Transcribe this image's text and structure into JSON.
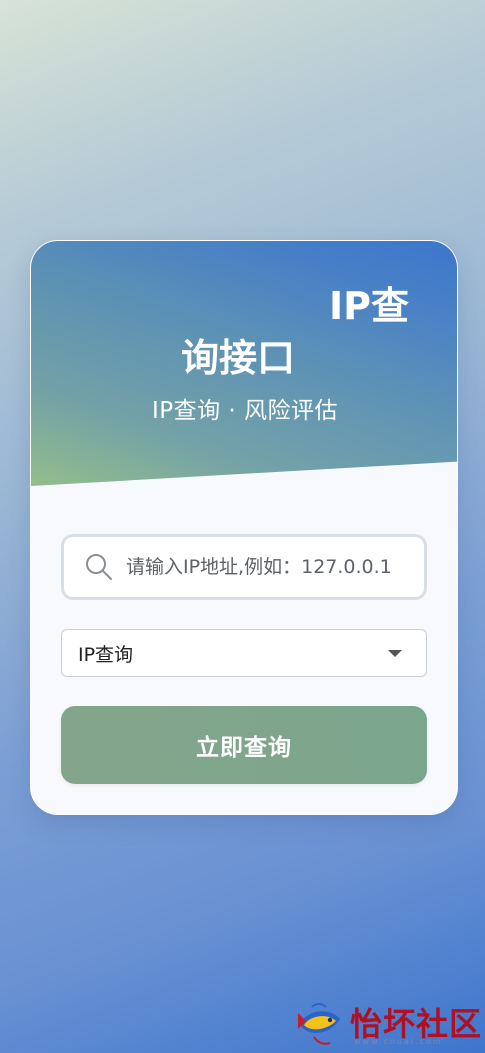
{
  "header": {
    "title_line1": "IP查",
    "title_line2": "询接口",
    "subtitle": "IP查询 · 风险评估"
  },
  "search": {
    "placeholder": "请输入IP地址,例如：127.0.0.1",
    "value": ""
  },
  "query_type": {
    "selected": "IP查询"
  },
  "submit": {
    "label": "立即查询"
  },
  "watermark": {
    "text": "怡坏社区",
    "url": "www.cnuai.com"
  },
  "colors": {
    "button": "#7ea58c",
    "header_start": "#8fbb86",
    "header_end": "#3c76cc",
    "watermark_red": "#b10f22"
  }
}
